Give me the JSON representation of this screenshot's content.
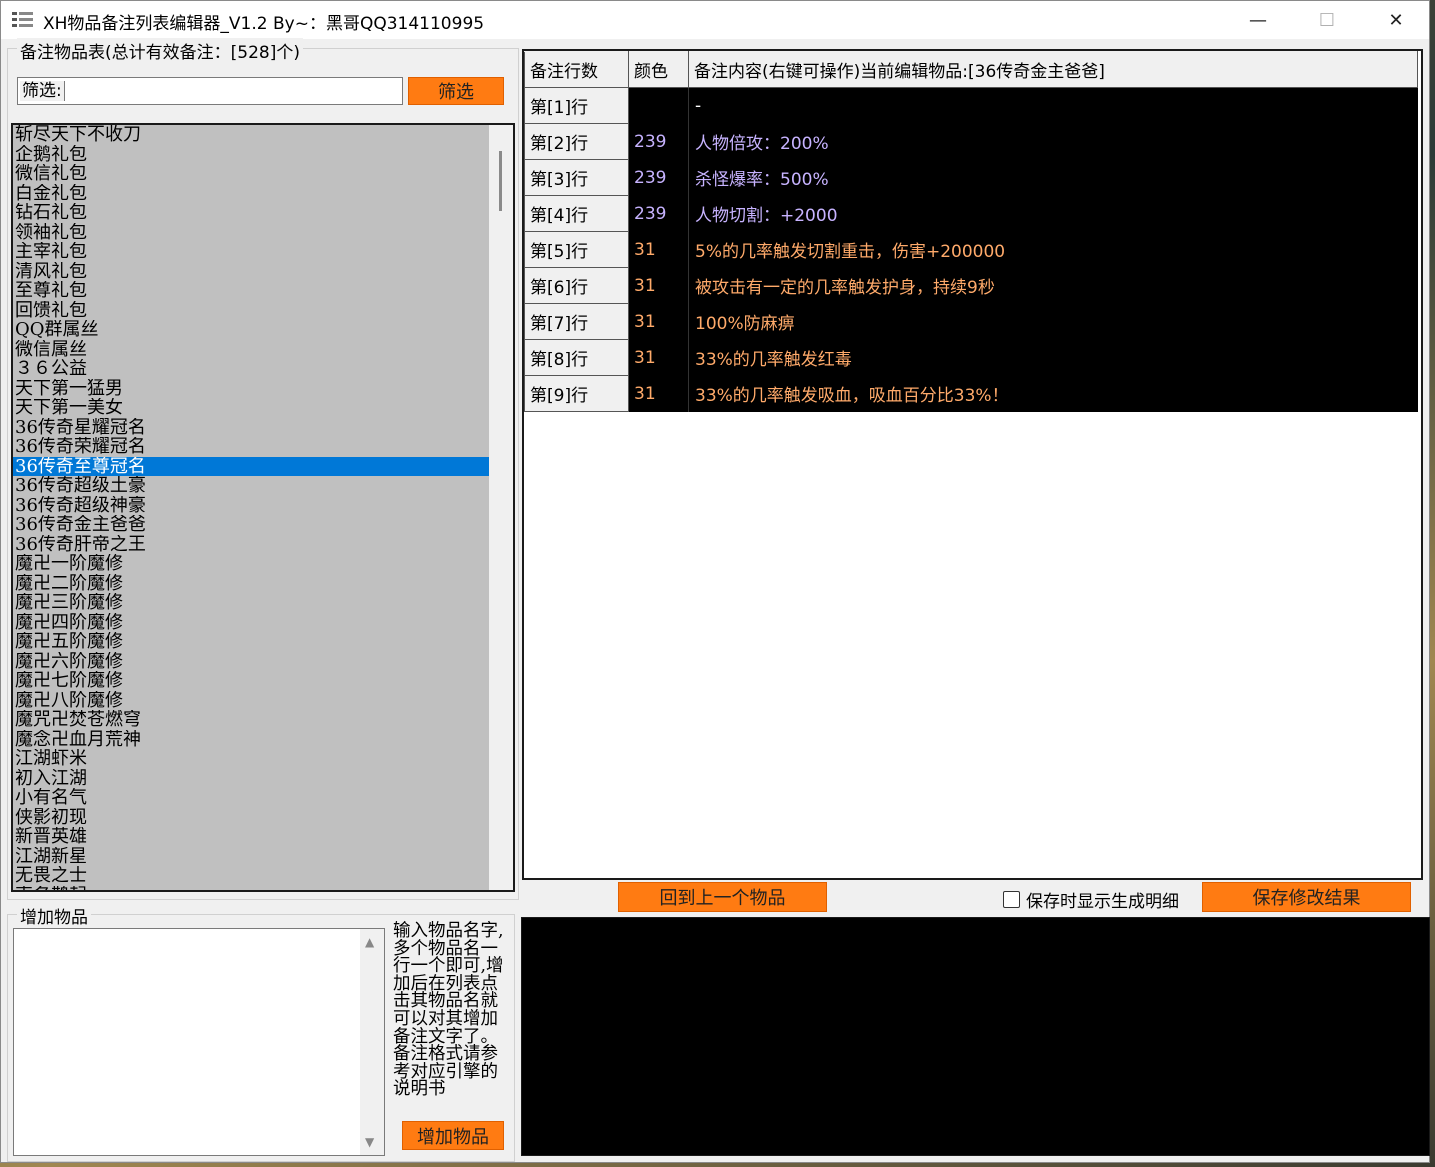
{
  "window": {
    "title": "XH物品备注列表编辑器_V1.2 By~：黑哥QQ314110995",
    "min_glyph": "—",
    "max_glyph": "☐",
    "close_glyph": "✕"
  },
  "left_panel": {
    "group_label": "备注物品表(总计有效备注：[528]个)",
    "filter_label": "筛选:",
    "filter_value": "",
    "filter_button": "筛选",
    "items": [
      "斩尽天下不收刀",
      "企鹅礼包",
      "微信礼包",
      "白金礼包",
      "钻石礼包",
      "领袖礼包",
      "主宰礼包",
      "清风礼包",
      "至尊礼包",
      "回馈礼包",
      "QQ群属丝",
      "微信属丝",
      "３６公益",
      "天下第一猛男",
      "天下第一美女",
      "36传奇星耀冠名",
      "36传奇荣耀冠名",
      "36传奇至尊冠名",
      "36传奇超级土豪",
      "36传奇超级神豪",
      "36传奇金主爸爸",
      "36传奇肝帝之王",
      "魔卍一阶魔修",
      "魔卍二阶魔修",
      "魔卍三阶魔修",
      "魔卍四阶魔修",
      "魔卍五阶魔修",
      "魔卍六阶魔修",
      "魔卍七阶魔修",
      "魔卍八阶魔修",
      "魔咒卍焚苍燃穹",
      "魔念卍血月荒神",
      "江湖虾米",
      "初入江湖",
      "小有名气",
      "侠影初现",
      "新晋英雄",
      "江湖新星",
      "无畏之士",
      "声名鹊起"
    ],
    "selected_index": 17
  },
  "add_panel": {
    "group_label": "增加物品",
    "textarea_value": "",
    "help_text": "输入物品名字,多个物品名一行一个即可,增加后在列表点击其物品名就可以对其增加备注文字了。备注格式请参考对应引擎的说明书",
    "add_button": "增加物品"
  },
  "table": {
    "headers": [
      "备注行数",
      "颜色",
      "备注内容(右键可操作)当前编辑物品:[36传奇金主爸爸]"
    ],
    "rows": [
      {
        "row": "第[1]行",
        "color": "",
        "content": "-",
        "text_color": "#ffffff"
      },
      {
        "row": "第[2]行",
        "color": "239",
        "content": "人物倍攻：200%",
        "text_color": "#c7b3ff"
      },
      {
        "row": "第[3]行",
        "color": "239",
        "content": "杀怪爆率：500%",
        "text_color": "#c7b3ff"
      },
      {
        "row": "第[4]行",
        "color": "239",
        "content": "人物切割：+2000",
        "text_color": "#c7b3ff"
      },
      {
        "row": "第[5]行",
        "color": "31",
        "content": "5%的几率触发切割重击，伤害+200000",
        "text_color": "#ffaa6a"
      },
      {
        "row": "第[6]行",
        "color": "31",
        "content": "被攻击有一定的几率触发护身，持续9秒",
        "text_color": "#ffaa6a"
      },
      {
        "row": "第[7]行",
        "color": "31",
        "content": "100%防麻痹",
        "text_color": "#ffaa6a"
      },
      {
        "row": "第[8]行",
        "color": "31",
        "content": "33%的几率触发红毒",
        "text_color": "#ffaa6a"
      },
      {
        "row": "第[9]行",
        "color": "31",
        "content": "33%的几率触发吸血，吸血百分比33%！",
        "text_color": "#ffaa6a"
      }
    ]
  },
  "bottom_bar": {
    "back_button": "回到上一个物品",
    "checkbox_label": "保存时显示生成明细",
    "checkbox_checked": false,
    "save_button": "保存修改结果"
  },
  "colors": {
    "accent_orange": "#ff7b12",
    "selection_blue": "#0078d7",
    "list_bg": "#c0c0c0"
  }
}
